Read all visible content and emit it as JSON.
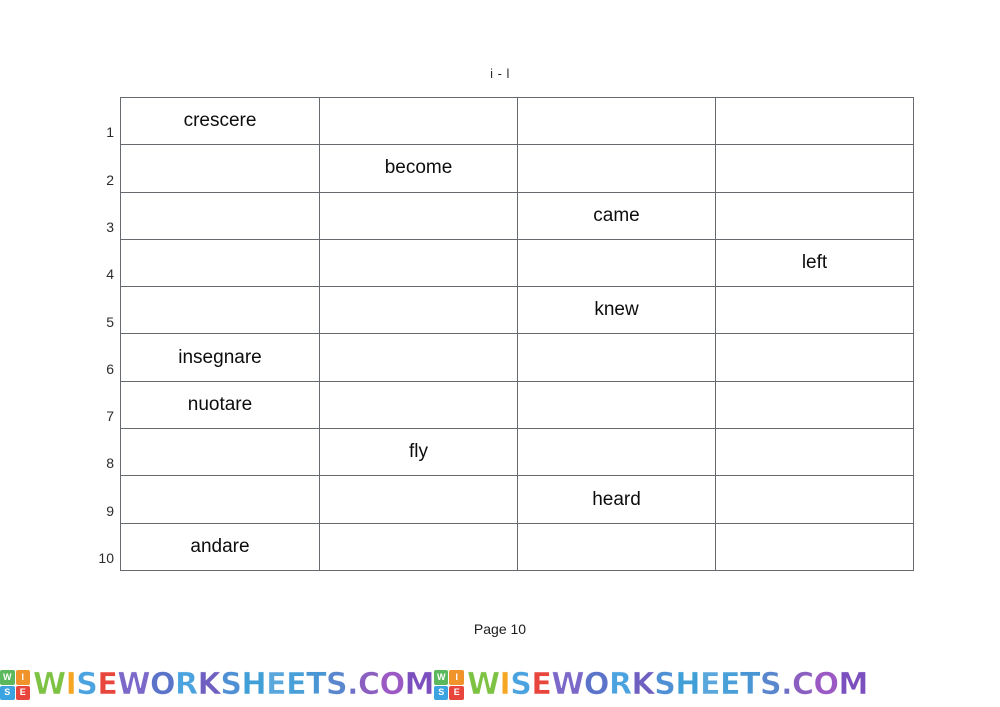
{
  "worksheet": {
    "title": "i - l",
    "footer": "Page 10"
  },
  "table": {
    "column_count": 4,
    "row_count": 10,
    "rows": [
      {
        "number": "1",
        "cells": [
          "crescere",
          "",
          "",
          ""
        ]
      },
      {
        "number": "2",
        "cells": [
          "",
          "become",
          "",
          ""
        ]
      },
      {
        "number": "3",
        "cells": [
          "",
          "",
          "came",
          ""
        ]
      },
      {
        "number": "4",
        "cells": [
          "",
          "",
          "",
          "left"
        ]
      },
      {
        "number": "5",
        "cells": [
          "",
          "",
          "knew",
          ""
        ]
      },
      {
        "number": "6",
        "cells": [
          "insegnare",
          "",
          "",
          ""
        ]
      },
      {
        "number": "7",
        "cells": [
          "nuotare",
          "",
          "",
          ""
        ]
      },
      {
        "number": "8",
        "cells": [
          "",
          "fly",
          "",
          ""
        ]
      },
      {
        "number": "9",
        "cells": [
          "",
          "",
          "heard",
          ""
        ]
      },
      {
        "number": "10",
        "cells": [
          "andare",
          "",
          "",
          ""
        ]
      }
    ]
  },
  "watermark": {
    "logo_letters": [
      "W",
      "I",
      "S",
      "E"
    ],
    "logo_colors": [
      "#5cb85c",
      "#f0932b",
      "#3ba3e0",
      "#e8453c"
    ],
    "text": "WISEWORKSHEETS.COM",
    "letter_colors": [
      "#7dc242",
      "#f5a623",
      "#4aa3df",
      "#e8453c",
      "#7b68c9",
      "#5b74c9",
      "#4aa3df",
      "#6f5fc0",
      "#4f8fd4",
      "#3f9fd6",
      "#5aa7dd",
      "#49a0d8",
      "#4a95d4",
      "#5a86cd",
      "#6f6fc6",
      "#8a5fc0",
      "#9b59c4",
      "#7b4fbd"
    ],
    "repeat_count": 2
  },
  "colors": {
    "table_border": "#666a6e",
    "text": "#0d0d0d",
    "page_background": "#ffffff"
  }
}
